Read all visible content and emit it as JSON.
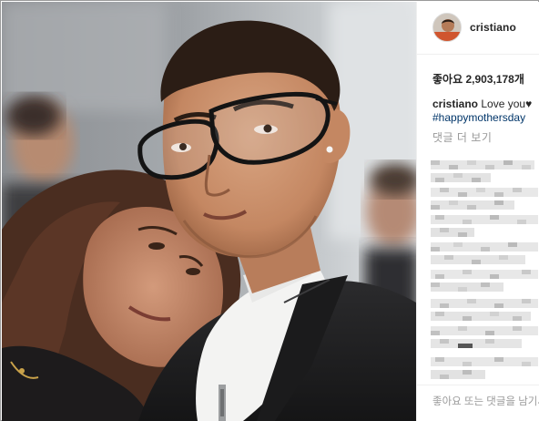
{
  "post": {
    "username": "cristiano",
    "likes_text": "좋아요 2,903,178개",
    "caption": {
      "author": "cristiano",
      "text": "Love you",
      "heart": "♥",
      "hashtag": "#happymothersday"
    },
    "view_more_comments": "댓글 더 보기",
    "comment_placeholder": "좋아요 또는 댓글을 남기세요..."
  },
  "icons": {
    "avatar": "profile-avatar",
    "heart": "heart-icon"
  },
  "colors": {
    "hashtag": "#003569",
    "muted": "#999999",
    "text": "#262626"
  }
}
